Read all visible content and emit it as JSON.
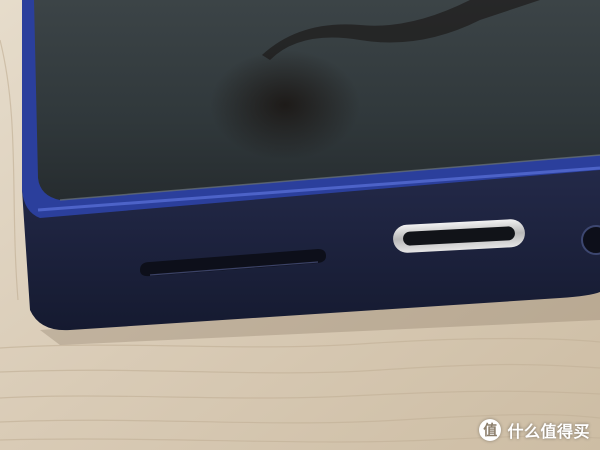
{
  "photo": {
    "subject": "device-bottom-edge-closeup",
    "colors": {
      "table": "#d9cbb6",
      "table_dark": "#bfae96",
      "screen": "#2e3436",
      "screen_highlight": "#5a6468",
      "bezel_blue": "#2b3f9c",
      "body_navy": "#1f2440",
      "port_silver": "#d8d8d8",
      "slot_dark": "#0d0f1a"
    }
  },
  "watermark": {
    "icon_glyph": "值",
    "text": "什么值得买"
  }
}
